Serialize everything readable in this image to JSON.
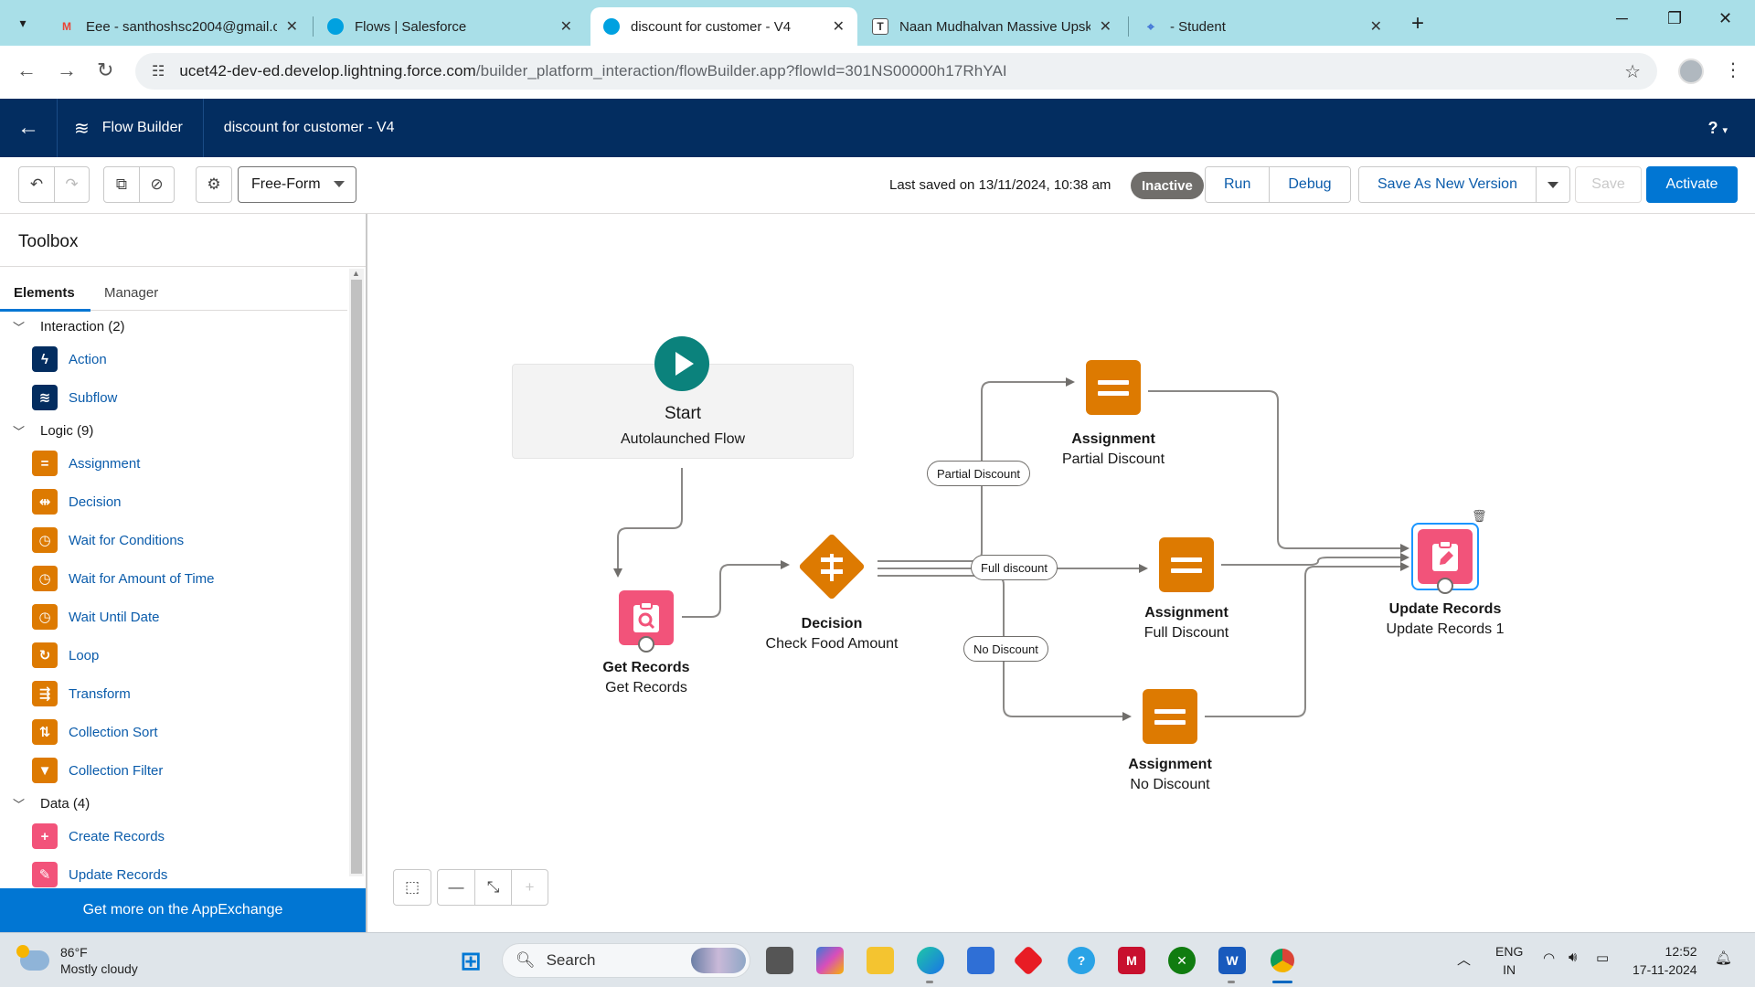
{
  "browser": {
    "tabs": [
      {
        "title": "Eee - santhoshsc2004@gmail.co",
        "icon": "gmail-icon",
        "active": false
      },
      {
        "title": "Flows | Salesforce",
        "icon": "salesforce-icon",
        "active": false
      },
      {
        "title": "discount for customer - V4",
        "icon": "salesforce-icon",
        "active": true
      },
      {
        "title": "Naan Mudhalvan Massive Upsk",
        "icon": "naan-mudhalvan-icon",
        "active": false
      },
      {
        "title": "- Student",
        "icon": "student-portal-icon",
        "active": false
      }
    ],
    "url_host": "ucet42-dev-ed.develop.lightning.force.com",
    "url_path": "/builder_platform_interaction/flowBuilder.app?flowId=301NS00000h17RhYAI"
  },
  "header": {
    "app_name": "Flow Builder",
    "flow_name": "discount for customer - V4",
    "help": "?"
  },
  "toolbar": {
    "canvas_mode": "Free-Form",
    "last_saved": "Last saved on 13/11/2024, 10:38 am",
    "status": "Inactive",
    "run": "Run",
    "debug": "Debug",
    "save_as_new_version": "Save As New Version",
    "save": "Save",
    "activate": "Activate"
  },
  "toolbox": {
    "title": "Toolbox",
    "tabs": [
      "Elements",
      "Manager"
    ],
    "groups": [
      {
        "label": "Interaction (2)",
        "items": [
          {
            "label": "Action",
            "icon": "bolt-icon",
            "color": "#032d60"
          },
          {
            "label": "Subflow",
            "icon": "subflow-icon",
            "color": "#032d60"
          }
        ]
      },
      {
        "label": "Logic (9)",
        "items": [
          {
            "label": "Assignment",
            "icon": "assignment-icon",
            "color": "#dd7a01"
          },
          {
            "label": "Decision",
            "icon": "decision-icon",
            "color": "#dd7a01"
          },
          {
            "label": "Wait for Conditions",
            "icon": "clock-icon",
            "color": "#dd7a01"
          },
          {
            "label": "Wait for Amount of Time",
            "icon": "clock-icon",
            "color": "#dd7a01"
          },
          {
            "label": "Wait Until Date",
            "icon": "clock-icon",
            "color": "#dd7a01"
          },
          {
            "label": "Loop",
            "icon": "loop-icon",
            "color": "#dd7a01"
          },
          {
            "label": "Transform",
            "icon": "transform-icon",
            "color": "#dd7a01"
          },
          {
            "label": "Collection Sort",
            "icon": "sort-icon",
            "color": "#dd7a01"
          },
          {
            "label": "Collection Filter",
            "icon": "filter-icon",
            "color": "#dd7a01"
          }
        ]
      },
      {
        "label": "Data (4)",
        "items": [
          {
            "label": "Create Records",
            "icon": "create-records-icon",
            "color": "#f2537a"
          },
          {
            "label": "Update Records",
            "icon": "update-records-icon",
            "color": "#f2537a"
          }
        ]
      }
    ],
    "appexchange": "Get more on the AppExchange"
  },
  "canvas": {
    "start": {
      "title": "Start",
      "subtitle": "Autolaunched Flow"
    },
    "get_records": {
      "title": "Get Records",
      "subtitle": "Get Records"
    },
    "decision": {
      "title": "Decision",
      "subtitle": "Check Food Amount"
    },
    "assign_partial": {
      "title": "Assignment",
      "subtitle": "Partial Discount"
    },
    "assign_full": {
      "title": "Assignment",
      "subtitle": "Full Discount"
    },
    "assign_none": {
      "title": "Assignment",
      "subtitle": "No Discount"
    },
    "update_records": {
      "title": "Update Records",
      "subtitle": "Update Records 1"
    },
    "outcomes": {
      "partial": "Partial Discount",
      "full": "Full discount",
      "none": "No Discount"
    }
  },
  "taskbar": {
    "temperature": "86°F",
    "weather": "Mostly cloudy",
    "search": "Search",
    "lang_1": "ENG",
    "lang_2": "IN",
    "time": "12:52",
    "date": "17-11-2024"
  },
  "colors": {
    "salesforce_navy": "#032d60",
    "brand_blue": "#0176d3",
    "logic_orange": "#dd7a01",
    "data_pink": "#f2537a",
    "start_teal": "#0b827c"
  }
}
